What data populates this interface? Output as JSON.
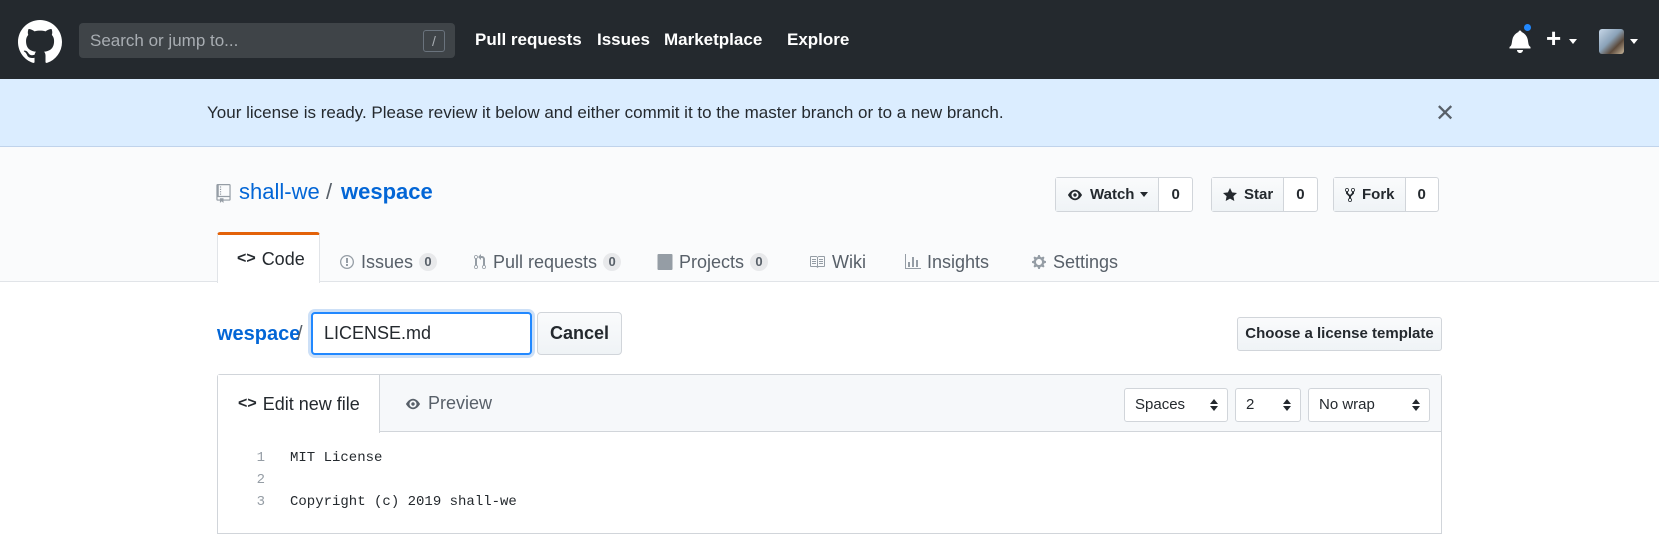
{
  "header": {
    "search_placeholder": "Search or jump to...",
    "slash_key": "/",
    "nav": [
      "Pull requests",
      "Issues",
      "Marketplace",
      "Explore"
    ],
    "plus": "+"
  },
  "flash": {
    "message": "Your license is ready. Please review it below and either commit it to the master branch or to a new branch.",
    "close": "✕"
  },
  "repo": {
    "owner": "shall-we",
    "separator": "/",
    "name": "wespace",
    "watch_label": "Watch",
    "watch_count": "0",
    "star_label": "Star",
    "star_count": "0",
    "fork_label": "Fork",
    "fork_count": "0"
  },
  "tabs": [
    {
      "label": "Code"
    },
    {
      "label": "Issues",
      "count": "0"
    },
    {
      "label": "Pull requests",
      "count": "0"
    },
    {
      "label": "Projects",
      "count": "0"
    },
    {
      "label": "Wiki"
    },
    {
      "label": "Insights"
    },
    {
      "label": "Settings"
    }
  ],
  "file": {
    "root": "wespace",
    "separator": "/",
    "filename": "LICENSE.md",
    "cancel_label": "Cancel",
    "license_template_label": "Choose a license template"
  },
  "editor": {
    "edit_tab": "Edit new file",
    "preview_tab": "Preview",
    "indent_mode": "Spaces",
    "indent_size": "2",
    "wrap_mode": "No wrap",
    "lines": [
      {
        "n": "1",
        "text": "MIT License"
      },
      {
        "n": "2",
        "text": ""
      },
      {
        "n": "3",
        "text": "Copyright (c) 2019 shall-we"
      }
    ]
  },
  "colors": {
    "header_bg": "#24292e",
    "flash_bg": "#dbedff",
    "link": "#0366d6",
    "selected_tab_accent": "#e36209",
    "focus": "#2188ff"
  }
}
